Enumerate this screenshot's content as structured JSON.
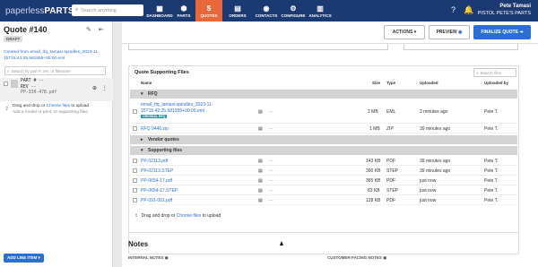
{
  "nav": {
    "logo_main": "paperless",
    "logo_accent": "PARTS",
    "search_placeholder": "Search anything",
    "items": [
      {
        "label": "DASHBOARD",
        "icon": "▦"
      },
      {
        "label": "PARTS",
        "icon": "⬢"
      },
      {
        "label": "QUOTES",
        "icon": "$"
      },
      {
        "label": "ORDERS",
        "icon": "▤"
      },
      {
        "label": "CONTACTS",
        "icon": "◉"
      },
      {
        "label": "CONFIGURE",
        "icon": "⚙"
      },
      {
        "label": "ANALYTICS",
        "icon": "▥"
      }
    ],
    "user_name": "Pete Tamasi",
    "user_company": "PISTOL PETE'S PARTS"
  },
  "quote": {
    "title": "Quote #140",
    "status": "DRAFT",
    "created_line": "Created from email_rfq_tamasi-spindles_2023-11-15T15:42:25.581955+00:00.eml",
    "part_search_placeholder": "Search by part #, rev, or filename",
    "part_number_label": "PART #",
    "part_number_value": "--",
    "rev_label": "REV",
    "rev_value": "--",
    "part_file": "PP-330-478.pdf",
    "drop_text": "Drag and drop or",
    "drop_link": "Choose files",
    "drop_suffix": "to upload",
    "drop_sub": "Add a model or print, or supporting files",
    "add_line_item": "ADD LINE ITEM"
  },
  "actions": {
    "actions_label": "ACTIONS",
    "preview_label": "PREVIEW",
    "finalize_label": "FINALIZE QUOTE"
  },
  "files": {
    "title": "Quote Supporting Files",
    "search_placeholder": "Search files",
    "columns": {
      "name": "Name",
      "size": "Size",
      "type": "Type",
      "uploaded": "Uploaded",
      "uploaded_by": "Uploaded by"
    },
    "groups": {
      "rfq": "RFQ",
      "vendor": "Vendor quotes",
      "supporting": "Supporting files"
    },
    "rfq_rows": [
      {
        "name": "email_rfq_tamasi-spindles_2023-11-15T15:42:25.581955+00:00.eml",
        "badge": "ORIGINAL RFQ",
        "size": "2 MB",
        "type": "EML",
        "uploaded": "2 minutes ago",
        "by": "Pete T."
      },
      {
        "name": "RFQ 9446.zip",
        "badge": "",
        "size": "1 MB",
        "type": "ZIP",
        "uploaded": "39 minutes ago",
        "by": "Pete T."
      }
    ],
    "supporting_rows": [
      {
        "name": "PP-02113.pdf",
        "size": "143 KB",
        "type": "PDF",
        "uploaded": "39 minutes ago",
        "by": "Pete T."
      },
      {
        "name": "PP-02113.STEP",
        "size": "390 KB",
        "type": "STEP",
        "uploaded": "39 minutes ago",
        "by": "Pete T."
      },
      {
        "name": "PP-0654-17.pdf",
        "size": "365 KB",
        "type": "PDF",
        "uploaded": "just now",
        "by": "Pete T."
      },
      {
        "name": "PP-0654-17.STEP",
        "size": "83 KB",
        "type": "STEP",
        "uploaded": "just now",
        "by": "Pete T."
      },
      {
        "name": "PP-091-001.pdf",
        "size": "128 KB",
        "type": "PDF",
        "uploaded": "just now",
        "by": "Pete T."
      }
    ],
    "drop_text": "Drag and drop or",
    "drop_link": "Choose files",
    "drop_suffix": "to upload"
  },
  "notes": {
    "title": "Notes",
    "internal": "INTERNAL NOTES",
    "customer": "CUSTOMER-FACING NOTES"
  },
  "colors": {
    "nav_bg": "#1c3a72",
    "accent": "#e8683a",
    "primary": "#2a6fd6",
    "badge": "#1a9ba8"
  }
}
